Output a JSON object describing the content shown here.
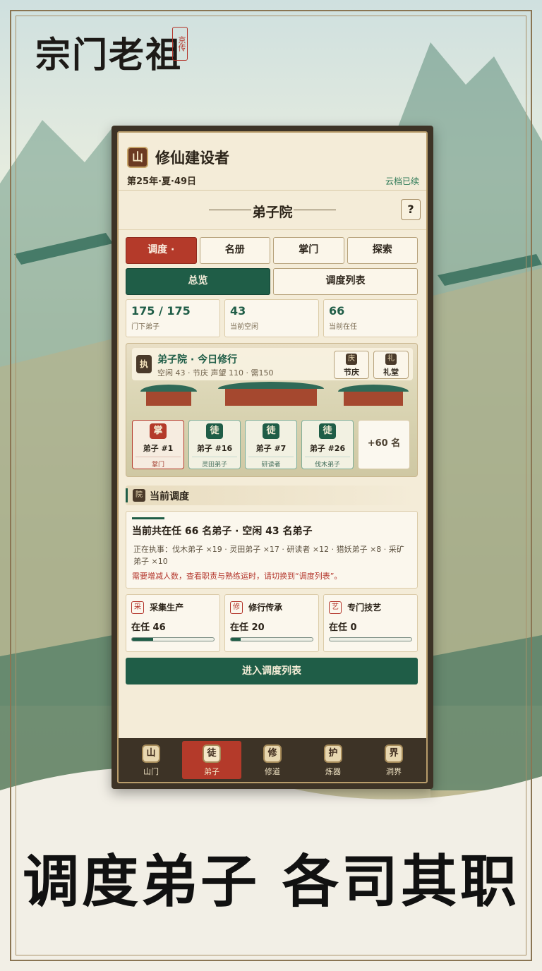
{
  "branding": {
    "logo_text": "宗门老祖",
    "seal_text": "京传",
    "slogan": "调度弟子 各司其职"
  },
  "header": {
    "icon": "山",
    "title": "修仙建设者",
    "date": "第25年·夏·49日",
    "save_status": "云档已续"
  },
  "section": {
    "title": "弟子院",
    "help": "?"
  },
  "tabs": [
    {
      "label": "调度 ·",
      "active": true
    },
    {
      "label": "名册",
      "active": false
    },
    {
      "label": "掌门",
      "active": false
    },
    {
      "label": "探索",
      "active": false
    }
  ],
  "subtabs": [
    {
      "label": "总览",
      "active": true
    },
    {
      "label": "调度列表",
      "active": false
    }
  ],
  "stats": [
    {
      "value": "175 / 175",
      "label": "门下弟子"
    },
    {
      "value": "43",
      "label": "当前空闲"
    },
    {
      "value": "66",
      "label": "当前在任"
    }
  ],
  "court": {
    "seal": "执",
    "title": "弟子院 · 今日修行",
    "subtitle": "空闲 43 · 节庆 声望 110 · 需150",
    "buttons": [
      {
        "icon": "庆",
        "label": "节庆"
      },
      {
        "icon": "礼",
        "label": "礼堂"
      }
    ],
    "cards": [
      {
        "badge": "掌",
        "name": "弟子 #1",
        "role": "掌门",
        "lead": true
      },
      {
        "badge": "徒",
        "name": "弟子 #16",
        "role": "灵田弟子",
        "lead": false
      },
      {
        "badge": "徒",
        "name": "弟子 #7",
        "role": "研读者",
        "lead": false
      },
      {
        "badge": "徒",
        "name": "弟子 #26",
        "role": "伐木弟子",
        "lead": false
      }
    ],
    "more": "+60 名"
  },
  "current": {
    "icon": "院",
    "title": "当前调度",
    "main": "当前共在任 66 名弟子 · 空闲 43 名弟子",
    "detail": "正在执事：伐木弟子 ×19 · 灵田弟子 ×17 · 研读者 ×12 · 猎妖弟子 ×8 · 采矿弟子 ×10",
    "warning": "需要增减人数，查看职责与熟练运时，请切换到“调度列表”。"
  },
  "jobs": [
    {
      "icon": "采",
      "name": "采集生产",
      "count": "在任 46",
      "progress": 0.26
    },
    {
      "icon": "修",
      "name": "修行传承",
      "count": "在任 20",
      "progress": 0.12
    },
    {
      "icon": "艺",
      "name": "专门技艺",
      "count": "在任 0",
      "progress": 0
    }
  ],
  "enter_button": "进入调度列表",
  "nav": [
    {
      "icon": "山",
      "label": "山门",
      "active": false
    },
    {
      "icon": "徒",
      "label": "弟子",
      "active": true
    },
    {
      "icon": "修",
      "label": "修道",
      "active": false
    },
    {
      "icon": "护",
      "label": "炼器",
      "active": false
    },
    {
      "icon": "界",
      "label": "洞界",
      "active": false
    }
  ]
}
